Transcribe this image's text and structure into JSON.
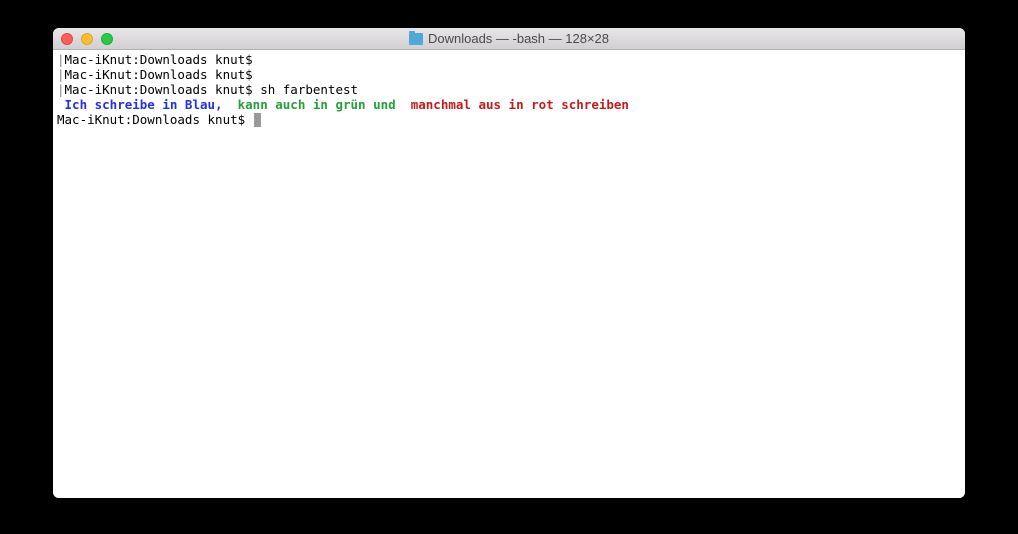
{
  "window": {
    "title": "Downloads — -bash — 128×28"
  },
  "terminal": {
    "lines": [
      {
        "pipe": "|",
        "prompt": "Mac-iKnut:Downloads knut$ ",
        "cmd": ""
      },
      {
        "pipe": "|",
        "prompt": "Mac-iKnut:Downloads knut$ ",
        "cmd": ""
      },
      {
        "pipe": "|",
        "prompt": "Mac-iKnut:Downloads knut$ ",
        "cmd": "sh farbentest"
      }
    ],
    "colored": {
      "blue": " Ich schreibe in Blau,  ",
      "green": "kann auch in grün und  ",
      "red": "manchmal aus in rot schreiben"
    },
    "last": {
      "pipe": "",
      "prompt": "Mac-iKnut:Downloads knut$ "
    }
  }
}
